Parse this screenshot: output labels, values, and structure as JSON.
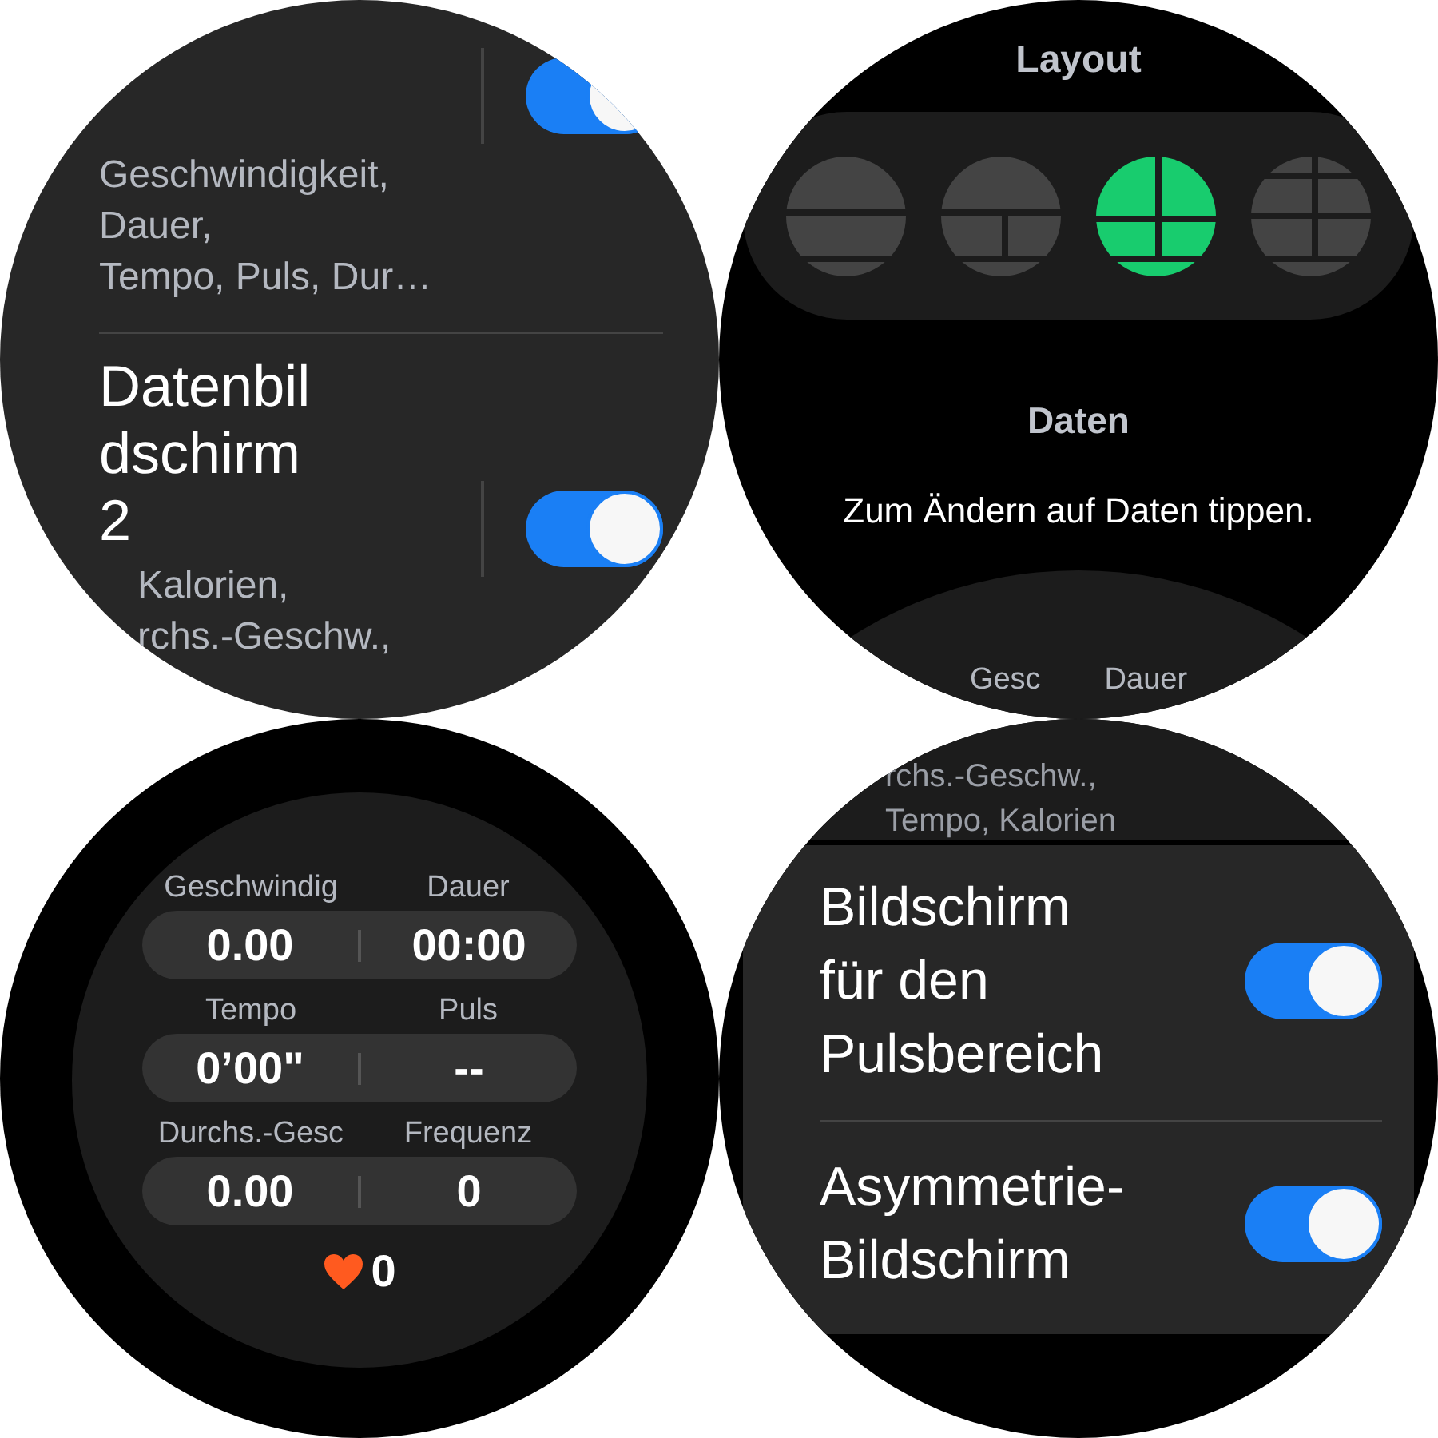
{
  "data_screens_list": {
    "items": [
      {
        "summary_lines": [
          "Geschwindigkeit,",
          "Dauer,",
          "Tempo, Puls, Dur…"
        ],
        "on": true
      },
      {
        "title_lines": [
          "Datenbil",
          "dschirm",
          "2"
        ],
        "summary_lines": [
          "Kalorien,",
          "rchs.-Geschw.,"
        ],
        "on": true
      }
    ]
  },
  "layout_picker": {
    "title": "Layout",
    "layouts": [
      {
        "kind": "rows",
        "selected": false
      },
      {
        "kind": "rows-split",
        "selected": false
      },
      {
        "kind": "quad",
        "selected": true
      },
      {
        "kind": "six",
        "selected": false
      }
    ],
    "data_title": "Daten",
    "hint": "Zum Ändern auf Daten tippen.",
    "preview_labels": [
      "Gesc",
      "Dauer"
    ]
  },
  "data_preview": {
    "fields": [
      {
        "label": "Geschwindig",
        "value": "0.00"
      },
      {
        "label": "Dauer",
        "value": "00:00"
      },
      {
        "label": "Tempo",
        "value": "0’00\""
      },
      {
        "label": "Puls",
        "value": "--"
      },
      {
        "label": "Durchs.-Gesc",
        "value": "0.00"
      },
      {
        "label": "Frequenz",
        "value": "0"
      }
    ],
    "heart_value": "0"
  },
  "extra_screens": {
    "summary_lines": [
      "rchs.-Geschw.,",
      "Tempo, Kalorien"
    ],
    "items": [
      {
        "title_lines": [
          "Bildschirm",
          "für den",
          "Pulsbereich"
        ],
        "on": true
      },
      {
        "title_lines": [
          "Asymmetrie-",
          "Bildschirm"
        ],
        "on": true
      }
    ]
  }
}
